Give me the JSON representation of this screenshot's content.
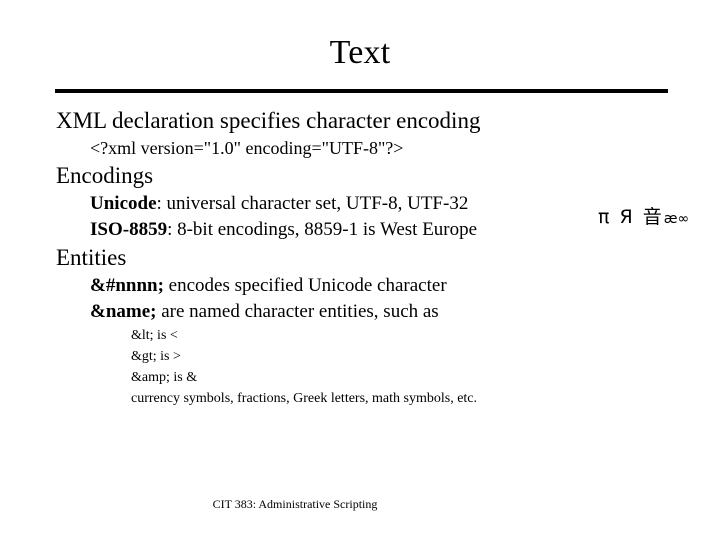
{
  "slide": {
    "title": "Text",
    "footer": "CIT 383: Administrative Scripting"
  },
  "content": {
    "xml_declaration_heading": "XML declaration specifies character encoding",
    "xml_declaration_code": "<?xml version=\"1.0\" encoding=\"UTF-8\"?>",
    "encodings_heading": "Encodings",
    "unicode_label": "Unicode",
    "unicode_text": ": universal character set, UTF-8, UTF-32",
    "iso_label": "ISO-8859",
    "iso_text": ": 8-bit encodings, 8859-1 is West Europe",
    "entities_heading": "Entities",
    "numeric_entity_label": "&#nnnn;",
    "numeric_entity_text": " encodes specified Unicode character",
    "named_entity_label": "&name;",
    "named_entity_text": " are named character entities, such as",
    "examples": [
      "&lt; is <",
      "&gt; is >",
      "&amp; is &",
      "currency symbols, fractions, Greek letters, math symbols, etc."
    ]
  },
  "glyphs": {
    "large": "π Я 音",
    "small": "æ∞"
  }
}
